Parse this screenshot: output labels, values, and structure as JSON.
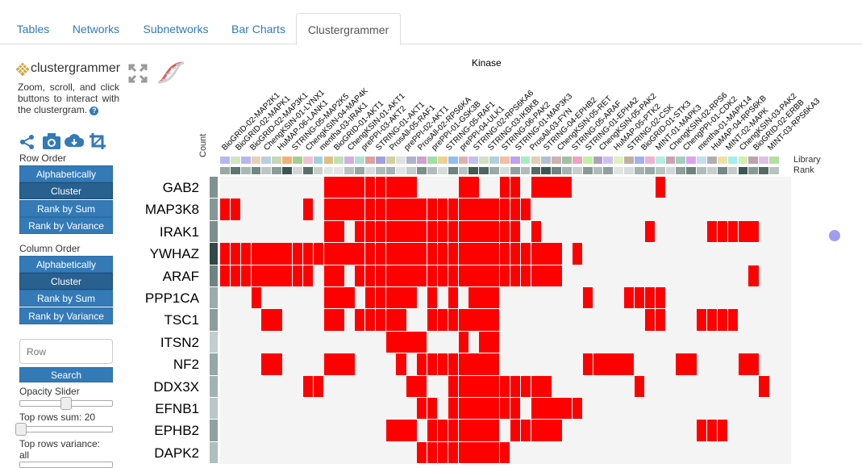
{
  "tabs": [
    {
      "label": "Tables",
      "active": false
    },
    {
      "label": "Networks",
      "active": false
    },
    {
      "label": "Subnetworks",
      "active": false
    },
    {
      "label": "Bar Charts",
      "active": false
    },
    {
      "label": "Clustergrammer",
      "active": true
    }
  ],
  "sidebar": {
    "logo_text": "clustergrammer",
    "about": "Zoom, scroll, and click buttons to interact with the clustergram.",
    "help_icon": "?",
    "row_order_label": "Row Order",
    "row_order_buttons": [
      "Alphabetically",
      "Cluster",
      "Rank by Sum",
      "Rank by Variance"
    ],
    "row_order_active": 1,
    "col_order_label": "Column Order",
    "col_order_buttons": [
      "Alphabetically",
      "Cluster",
      "Rank by Sum",
      "Rank by Variance"
    ],
    "col_order_active": 1,
    "search_placeholder": "Row",
    "search_button": "Search",
    "opacity_label": "Opacity Slider",
    "opacity_value": 0.5,
    "top_sum_label": "Top rows sum: 20",
    "top_sum_value": 0,
    "top_var_label": "Top rows variance:",
    "top_var_value_text": "all",
    "icons": [
      "share-icon",
      "camera-icon",
      "download-icon",
      "crop-icon"
    ]
  },
  "clustergram": {
    "title": "Kinase",
    "count_label": "Count",
    "library_label": "Library",
    "rank_label": "Rank",
    "rows": [
      "GAB2",
      "MAP3K8",
      "IRAK1",
      "YWHAZ",
      "ARAF",
      "PPP1CA",
      "TSC1",
      "ITSN2",
      "NF2",
      "DDX3X",
      "EFNB1",
      "EPHB2",
      "DAPK2"
    ],
    "row_shades": [
      "#7f9290",
      "#859998",
      "#7c918e",
      "#2f4a47",
      "#6c8483",
      "#9aacab",
      "#8b9e9d",
      "#c3cdcd",
      "#95a8a6",
      "#a2b3b1",
      "#bcc6c6",
      "#8fa2a0",
      "#b0bebc"
    ],
    "columns": [
      "BioGRID-02-MAP2K1",
      "BioGRID-02-MAPK1",
      "BioGRID-02-MAP3K1",
      "ChengKSIN-01-LYNX1",
      "HuMAP-06-LANK1",
      "STRING-05-MAP2K5",
      "ChengKSIN-04-MAP4K",
      "mentha-03-IRAK1",
      "BioGRID-01-AKT1",
      "ChengKSIN-01-AKT1",
      "prePPI-03-AKT2",
      "STRING-01-AKT1",
      "ProsAll-05-RAF1",
      "prePPI-02-AKT1",
      "ProsAll-02-RPS6KA",
      "prePPI-01-GSK3B",
      "STRING-05-RAF1",
      "prePPI-04-ULK1",
      "STRING-02-RPS6KA6",
      "STRING-03-IKBKB",
      "STRING-06-PAK2",
      "STRING-01-MAP3K3",
      "ProsAll-03-FYN",
      "STRING-04-EPHB2",
      "ChengKSIN-05-RET",
      "STRING-05-ARAF",
      "STRING-01-EPHA2",
      "ChengKSIN-05-PAK2",
      "HuMAP-05-PTK2",
      "STRING-02-CSK",
      "BioGRID-01-STK3",
      "MINT-01-MAPK3",
      "ChengKSIN-02-RPS6",
      "ChengPPI-01-CDK2",
      "mentha-01-MAPK14",
      "HuMAP-04-RPS6KB",
      "MINT-02-MAPK",
      "ChengKSIN-03-PAK2",
      "BioGRID-02-ERBB",
      "MINT-03-RPS6KA3"
    ],
    "matrix": [
      [
        0,
        0,
        0,
        0,
        0,
        0,
        0,
        0,
        0,
        0,
        1,
        1,
        1,
        1,
        1,
        1,
        1,
        1,
        1,
        0,
        0,
        0,
        0,
        1,
        1,
        0,
        0,
        1,
        1,
        0,
        1,
        1,
        1,
        1,
        0,
        0,
        0,
        0,
        0,
        0,
        0,
        0,
        1,
        0,
        0,
        0,
        0,
        0,
        0,
        0,
        0,
        0,
        0,
        0
      ],
      [
        1,
        1,
        0,
        0,
        0,
        0,
        0,
        0,
        1,
        0,
        1,
        1,
        1,
        1,
        1,
        1,
        1,
        1,
        1,
        1,
        1,
        1,
        1,
        1,
        1,
        1,
        1,
        1,
        1,
        1,
        0,
        0,
        0,
        0,
        0,
        0,
        0,
        0,
        0,
        0,
        0,
        0,
        0,
        0,
        0,
        0,
        0,
        0,
        0,
        0,
        0,
        0,
        0,
        0
      ],
      [
        0,
        0,
        0,
        0,
        0,
        0,
        0,
        0,
        0,
        0,
        1,
        1,
        0,
        1,
        1,
        1,
        1,
        1,
        1,
        1,
        1,
        1,
        1,
        1,
        1,
        1,
        1,
        1,
        1,
        0,
        1,
        0,
        0,
        0,
        0,
        0,
        0,
        0,
        0,
        0,
        0,
        1,
        0,
        0,
        0,
        0,
        0,
        1,
        1,
        1,
        1,
        1,
        0,
        0
      ],
      [
        1,
        1,
        1,
        1,
        1,
        1,
        1,
        1,
        1,
        1,
        1,
        1,
        1,
        1,
        1,
        1,
        1,
        1,
        1,
        1,
        1,
        1,
        1,
        1,
        1,
        1,
        1,
        1,
        1,
        1,
        1,
        1,
        1,
        0,
        1,
        0,
        0,
        0,
        0,
        0,
        0,
        0,
        0,
        0,
        0,
        0,
        0,
        0,
        0,
        0,
        0,
        0,
        0,
        0
      ],
      [
        1,
        1,
        1,
        1,
        1,
        1,
        1,
        1,
        1,
        0,
        1,
        1,
        0,
        1,
        1,
        1,
        1,
        1,
        1,
        1,
        1,
        1,
        1,
        1,
        1,
        1,
        1,
        1,
        1,
        1,
        1,
        1,
        1,
        0,
        0,
        0,
        0,
        0,
        0,
        0,
        0,
        0,
        0,
        0,
        0,
        0,
        0,
        0,
        0,
        0,
        0,
        1,
        0,
        0
      ],
      [
        0,
        0,
        0,
        1,
        0,
        0,
        0,
        0,
        0,
        0,
        1,
        1,
        1,
        0,
        1,
        1,
        1,
        1,
        1,
        0,
        1,
        0,
        1,
        0,
        1,
        1,
        1,
        0,
        0,
        0,
        0,
        0,
        0,
        0,
        0,
        1,
        0,
        0,
        0,
        1,
        1,
        1,
        1,
        0,
        0,
        0,
        0,
        0,
        0,
        0,
        0,
        0,
        0,
        0
      ],
      [
        0,
        0,
        0,
        0,
        1,
        1,
        0,
        0,
        0,
        0,
        1,
        1,
        0,
        1,
        1,
        1,
        1,
        1,
        0,
        0,
        1,
        1,
        1,
        1,
        1,
        1,
        1,
        0,
        0,
        0,
        0,
        0,
        0,
        0,
        0,
        0,
        0,
        0,
        0,
        0,
        0,
        1,
        1,
        0,
        0,
        0,
        1,
        1,
        1,
        1,
        0,
        0,
        0,
        0
      ],
      [
        0,
        0,
        0,
        0,
        0,
        0,
        0,
        0,
        0,
        0,
        0,
        0,
        0,
        0,
        0,
        0,
        1,
        1,
        1,
        1,
        0,
        0,
        0,
        1,
        0,
        1,
        1,
        0,
        0,
        0,
        0,
        0,
        0,
        0,
        0,
        0,
        0,
        0,
        0,
        0,
        0,
        0,
        0,
        0,
        0,
        0,
        0,
        0,
        0,
        0,
        0,
        0,
        0,
        0
      ],
      [
        0,
        0,
        0,
        0,
        1,
        1,
        0,
        0,
        0,
        0,
        1,
        1,
        1,
        0,
        0,
        0,
        0,
        1,
        0,
        1,
        1,
        1,
        1,
        1,
        1,
        1,
        1,
        0,
        0,
        0,
        0,
        0,
        0,
        0,
        0,
        1,
        1,
        1,
        1,
        1,
        0,
        0,
        0,
        0,
        1,
        1,
        0,
        0,
        0,
        0,
        1,
        1,
        0,
        0
      ],
      [
        0,
        0,
        0,
        0,
        0,
        0,
        0,
        0,
        1,
        1,
        0,
        0,
        0,
        0,
        0,
        0,
        0,
        0,
        1,
        1,
        0,
        0,
        1,
        1,
        1,
        1,
        1,
        1,
        1,
        1,
        1,
        1,
        0,
        0,
        0,
        0,
        0,
        0,
        0,
        0,
        1,
        0,
        0,
        0,
        0,
        0,
        0,
        0,
        0,
        0,
        0,
        0,
        1,
        0
      ],
      [
        0,
        0,
        0,
        0,
        0,
        0,
        0,
        0,
        0,
        0,
        0,
        0,
        0,
        0,
        0,
        0,
        0,
        0,
        0,
        1,
        1,
        0,
        1,
        1,
        1,
        1,
        1,
        1,
        1,
        0,
        1,
        1,
        1,
        1,
        1,
        0,
        0,
        0,
        0,
        0,
        0,
        0,
        0,
        0,
        0,
        0,
        0,
        0,
        0,
        0,
        0,
        0,
        0,
        0
      ],
      [
        0,
        0,
        0,
        0,
        0,
        0,
        0,
        0,
        0,
        0,
        0,
        0,
        0,
        0,
        0,
        0,
        1,
        1,
        1,
        0,
        1,
        1,
        1,
        1,
        1,
        1,
        1,
        0,
        1,
        1,
        1,
        1,
        1,
        0,
        0,
        0,
        0,
        0,
        0,
        0,
        0,
        0,
        0,
        0,
        0,
        0,
        1,
        1,
        1,
        0,
        0,
        0,
        0,
        0
      ],
      [
        0,
        0,
        0,
        0,
        0,
        0,
        0,
        0,
        0,
        0,
        0,
        0,
        0,
        0,
        0,
        0,
        0,
        0,
        0,
        1,
        1,
        1,
        1,
        1,
        1,
        1,
        1,
        1,
        0,
        0,
        0,
        0,
        0,
        0,
        0,
        0,
        0,
        0,
        0,
        0,
        0,
        0,
        0,
        0,
        0,
        0,
        0,
        0,
        0,
        0,
        0,
        0,
        0,
        0
      ]
    ],
    "library_colors": [
      "#b6b6f0",
      "#cfe6c0",
      "#b6b6f0",
      "#e8d0b0",
      "#b6cfe6",
      "#c6d6b6",
      "#f0b070",
      "#a0d090",
      "#f0c0d0",
      "#a0d0e0",
      "#e0c080",
      "#c0e0b0",
      "#d0b0e0",
      "#b0e0d0",
      "#e0a0a0",
      "#a0a0e0",
      "#d0d0a0",
      "#e0e0e0",
      "#b0b0d0",
      "#d0a0d0",
      "#a0e0a0",
      "#f0d090",
      "#90c0f0",
      "#e0b0b0",
      "#c0c0f0",
      "#d0e0c0",
      "#b0d0e0",
      "#f0c0a0",
      "#c0a0f0",
      "#a0f0c0",
      "#e0d0b0",
      "#b0c0d0",
      "#d0b0b0",
      "#a0c0a0",
      "#f0a0c0",
      "#c0f0a0",
      "#b0a0c0",
      "#d0c0f0",
      "#e0f0c0",
      "#c0b0a0",
      "#a0b0f0",
      "#f0b0d0",
      "#b0f0e0",
      "#d0a0b0",
      "#a0d0c0",
      "#e0a0f0",
      "#c0e0f0",
      "#b0b0b0",
      "#f0e0a0",
      "#a0f0f0",
      "#d0f0b0",
      "#c0a0b0",
      "#e0c0e0",
      "#b0e0a0"
    ],
    "rank_colors": [
      "#9aa8a6",
      "#5f7572",
      "#a9b7b5",
      "#728885",
      "#bcc6c5",
      "#8a9c9a",
      "#3e5653",
      "#d0d7d6",
      "#5a706d",
      "#c6cfce",
      "#e0e5e4",
      "#e0e5e4",
      "#b8c3c1",
      "#97a7a5",
      "#d6dcdb",
      "#adbab8",
      "#a4b2b0",
      "#e0e5e4",
      "#c2ccca",
      "#7b8f8c",
      "#b0bcbb",
      "#d6dcdb",
      "#6e8380",
      "#b8c3c1",
      "#405955",
      "#4e6663",
      "#98a8a6",
      "#d6dcdb",
      "#8fa09e",
      "#b0bcbb",
      "#536a67",
      "#3e5653",
      "#6e8380",
      "#a4b2b0",
      "#c6cfce",
      "#889a98",
      "#b0bcbb",
      "#8fa09e",
      "#e0e5e4",
      "#d6dcdb",
      "#a4b2b0",
      "#98a8a6",
      "#b8c3c1",
      "#d0d7d6",
      "#8fa09e",
      "#6e8380",
      "#b0bcbb",
      "#c6cfce",
      "#748885",
      "#c2ccca",
      "#3e5653",
      "#889a98",
      "#536a67",
      "#b8c3c1"
    ]
  }
}
